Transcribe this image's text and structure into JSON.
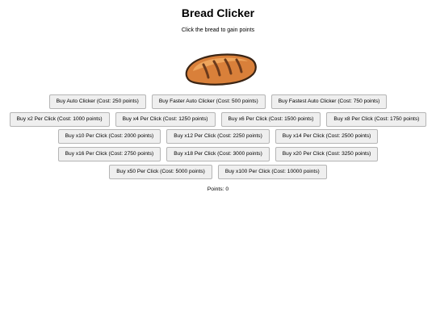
{
  "header": {
    "title": "Bread Clicker",
    "subtitle": "Click the bread to gain points"
  },
  "bread": {
    "icon": "bread-loaf-icon",
    "colors": {
      "crust": "#d9803a",
      "crust_light": "#efa860",
      "outline": "#3a2414",
      "score": "#6b3a1c"
    }
  },
  "upgrades": {
    "row1": [
      {
        "label": "Buy Auto Clicker (Cost: 250 points)"
      },
      {
        "label": "Buy Faster Auto Clicker (Cost: 500 points)"
      },
      {
        "label": "Buy Fastest Auto Clicker (Cost: 750 points)"
      }
    ],
    "row2": [
      {
        "label": "Buy x2 Per Click (Cost: 1000 points)"
      },
      {
        "label": "Buy x4 Per Click (Cost: 1250 points)"
      },
      {
        "label": "Buy x6 Per Click (Cost: 1500 points)"
      },
      {
        "label": "Buy x8 Per Click (Cost: 1750 points)"
      }
    ],
    "row3": [
      {
        "label": "Buy x10 Per Click (Cost: 2000 points)"
      },
      {
        "label": "Buy x12 Per Click (Cost: 2250 points)"
      },
      {
        "label": "Buy x14 Per Click (Cost: 2500 points)"
      }
    ],
    "row4": [
      {
        "label": "Buy x16 Per Click (Cost: 2750 points)"
      },
      {
        "label": "Buy x18 Per Click (Cost: 3000 points)"
      },
      {
        "label": "Buy x20 Per Click (Cost: 3250 points)"
      }
    ],
    "row5": [
      {
        "label": "Buy x50 Per Click (Cost: 5000 points)"
      },
      {
        "label": "Buy x100 Per Click (Cost: 10000 points)"
      }
    ]
  },
  "status": {
    "points_text": "Points: 0"
  }
}
